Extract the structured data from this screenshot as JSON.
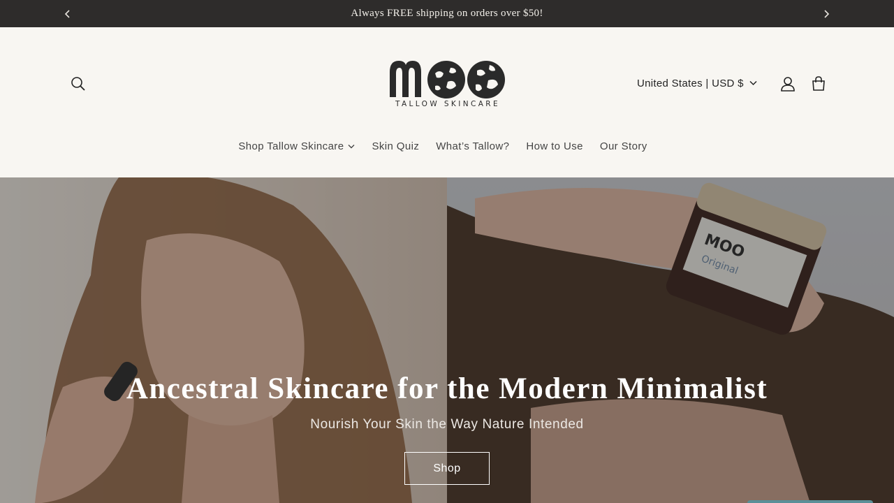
{
  "announcement": {
    "text": "Always FREE shipping on orders over $50!",
    "prev_icon": "chevron-left-icon",
    "next_icon": "chevron-right-icon"
  },
  "header": {
    "logo": {
      "wordmark": "MOO",
      "tagline": "TALLOW SKINCARE"
    },
    "locale_selector": "United States | USD $",
    "icons": [
      "search-icon",
      "account-icon",
      "cart-icon"
    ]
  },
  "nav": {
    "items": [
      {
        "label": "Shop Tallow Skincare",
        "has_dropdown": true
      },
      {
        "label": "Skin Quiz",
        "has_dropdown": false
      },
      {
        "label": "What’s Tallow?",
        "has_dropdown": false
      },
      {
        "label": "How to Use",
        "has_dropdown": false
      },
      {
        "label": "Our Story",
        "has_dropdown": false
      }
    ]
  },
  "hero": {
    "title": "Ancestral Skincare for the Modern Minimalist",
    "subtitle": "Nourish Your Skin the Way Nature Intended",
    "cta_label": "Shop"
  },
  "colors": {
    "announcement_bg": "#2e2c2b",
    "page_bg": "#f8f6f2",
    "text_dark": "#222222",
    "chat_chip": "#5b8f98"
  }
}
